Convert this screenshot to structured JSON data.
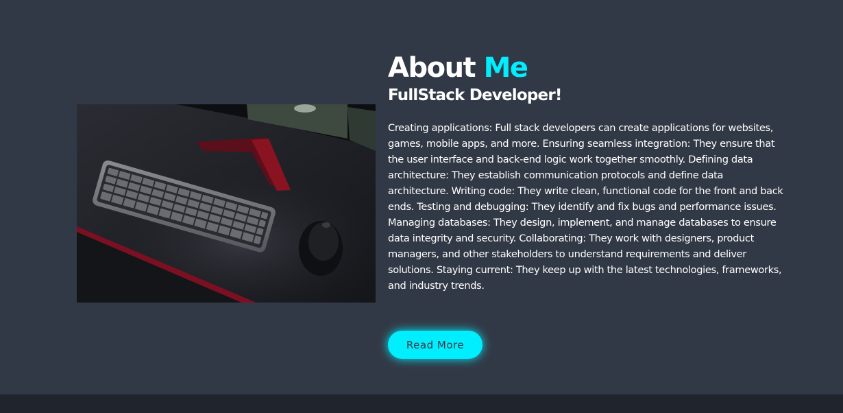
{
  "about": {
    "heading_main": "About ",
    "heading_accent": "Me",
    "subheading": "FullStack Developer!",
    "description": "Creating applications: Full stack developers can create applications for websites, games, mobile apps, and more. Ensuring seamless integration: They ensure that the user interface and back-end logic work together smoothly. Defining data architecture: They establish communication protocols and define data architecture. Writing code: They write clean, functional code for the front and back ends. Testing and debugging: They identify and fix bugs and performance issues. Managing databases: They design, implement, and manage databases to ensure data integrity and security. Collaborating: They work with designers, product managers, and other stakeholders to understand requirements and deliver solutions. Staying current: They keep up with the latest technologies, frameworks, and industry trends.",
    "button_label": "Read More",
    "image_icon": "desk-keyboard-photo"
  },
  "colors": {
    "background": "#323946",
    "footer_background": "#1f242d",
    "accent": "#00eeff",
    "text": "#ffffff"
  }
}
